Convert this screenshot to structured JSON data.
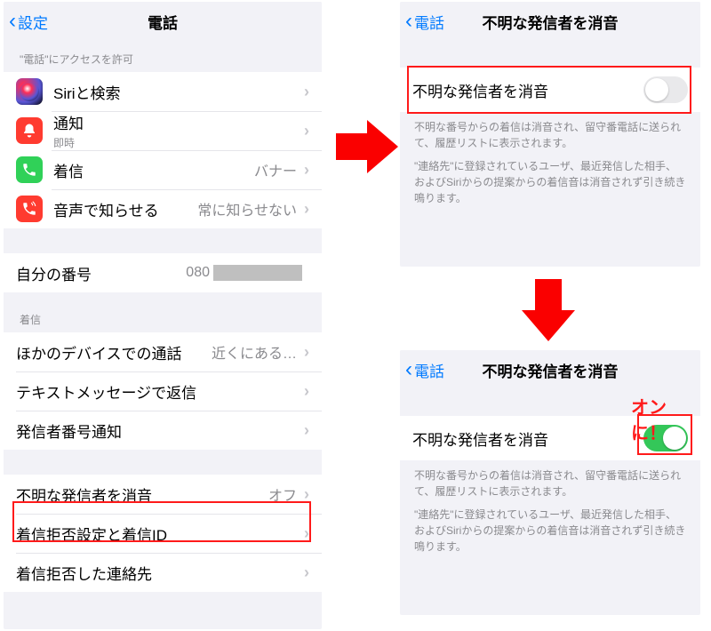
{
  "left": {
    "back": "設定",
    "title": "電話",
    "section_access": "\"電話\"にアクセスを許可",
    "siri_label": "Siriと検索",
    "notif_label": "通知",
    "notif_sub": "即時",
    "incoming_label": "着信",
    "incoming_value": "バナー",
    "voice_label": "音声で知らせる",
    "voice_value": "常に知らせない",
    "mynum_label": "自分の番号",
    "mynum_value": "080",
    "section_incoming": "着信",
    "otherdev_label": "ほかのデバイスでの通話",
    "otherdev_value": "近くにある…",
    "textreply_label": "テキストメッセージで返信",
    "callerid_label": "発信者番号通知",
    "silence_label": "不明な発信者を消音",
    "silence_value": "オフ",
    "block_label": "着信拒否設定と着信ID",
    "blocked_label": "着信拒否した連絡先"
  },
  "right": {
    "back": "電話",
    "title": "不明な発信者を消音",
    "toggle_label": "不明な発信者を消音",
    "desc1": "不明な番号からの着信は消音され、留守番電話に送られて、履歴リストに表示されます。",
    "desc2": "\"連絡先\"に登録されているユーザ、最近発信した相手、およびSiriからの提案からの着信音は消音されず引き続き鳴ります。",
    "callout": "オンに！"
  }
}
